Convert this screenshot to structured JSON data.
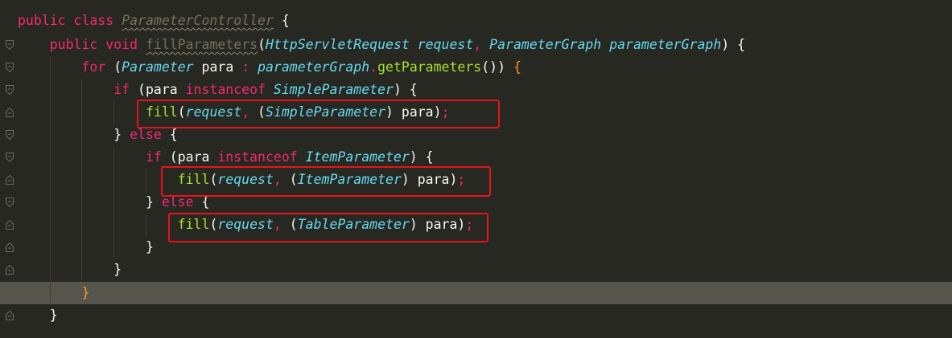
{
  "lines": [
    {
      "tokens": [
        [
          "kw",
          "public"
        ],
        [
          "plain",
          " "
        ],
        [
          "kw",
          "class"
        ],
        [
          "plain",
          " "
        ],
        [
          "clsu",
          "ParameterController"
        ],
        [
          "plain",
          " {"
        ]
      ]
    },
    {
      "tokens": [
        [
          "plain",
          "    "
        ],
        [
          "kw",
          "public"
        ],
        [
          "plain",
          " "
        ],
        [
          "kw",
          "void"
        ],
        [
          "plain",
          " "
        ],
        [
          "mu",
          "fillParameters"
        ],
        [
          "plain",
          "("
        ],
        [
          "typ",
          "HttpServletRequest"
        ],
        [
          "plain",
          " "
        ],
        [
          "prm",
          "request"
        ],
        [
          "kw",
          ","
        ],
        [
          "plain",
          " "
        ],
        [
          "typ",
          "ParameterGraph"
        ],
        [
          "plain",
          " "
        ],
        [
          "prm",
          "parameterGraph"
        ],
        [
          "plain",
          ") {"
        ]
      ]
    },
    {
      "tokens": [
        [
          "plain",
          "        "
        ],
        [
          "kw",
          "for"
        ],
        [
          "plain",
          " ("
        ],
        [
          "typ",
          "Parameter"
        ],
        [
          "plain",
          " para "
        ],
        [
          "kw",
          ":"
        ],
        [
          "plain",
          " "
        ],
        [
          "prm",
          "parameterGraph"
        ],
        [
          "kw",
          "."
        ],
        [
          "fn",
          "getParameters"
        ],
        [
          "plain",
          "()) "
        ],
        [
          "bh",
          "{"
        ]
      ]
    },
    {
      "tokens": [
        [
          "plain",
          "            "
        ],
        [
          "kw",
          "if"
        ],
        [
          "plain",
          " (para "
        ],
        [
          "kw",
          "instanceof"
        ],
        [
          "plain",
          " "
        ],
        [
          "typ",
          "SimpleParameter"
        ],
        [
          "plain",
          ") {"
        ]
      ]
    },
    {
      "tokens": [
        [
          "plain",
          "                "
        ],
        [
          "fn",
          "fill"
        ],
        [
          "plain",
          "("
        ],
        [
          "prm",
          "request"
        ],
        [
          "kw",
          ","
        ],
        [
          "plain",
          " ("
        ],
        [
          "typ",
          "SimpleParameter"
        ],
        [
          "plain",
          ") para)"
        ],
        [
          "semi",
          ";"
        ]
      ]
    },
    {
      "tokens": [
        [
          "plain",
          "            } "
        ],
        [
          "kw",
          "else"
        ],
        [
          "plain",
          " {"
        ]
      ]
    },
    {
      "tokens": [
        [
          "plain",
          "                "
        ],
        [
          "kw",
          "if"
        ],
        [
          "plain",
          " (para "
        ],
        [
          "kw",
          "instanceof"
        ],
        [
          "plain",
          " "
        ],
        [
          "typ",
          "ItemParameter"
        ],
        [
          "plain",
          ") {"
        ]
      ]
    },
    {
      "tokens": [
        [
          "plain",
          "                    "
        ],
        [
          "fn",
          "fill"
        ],
        [
          "plain",
          "("
        ],
        [
          "prm",
          "request"
        ],
        [
          "kw",
          ","
        ],
        [
          "plain",
          " ("
        ],
        [
          "typ",
          "ItemParameter"
        ],
        [
          "plain",
          ") para)"
        ],
        [
          "semi",
          ";"
        ]
      ]
    },
    {
      "tokens": [
        [
          "plain",
          "                } "
        ],
        [
          "kw",
          "else"
        ],
        [
          "plain",
          " {"
        ]
      ]
    },
    {
      "tokens": [
        [
          "plain",
          "                    "
        ],
        [
          "fn",
          "fill"
        ],
        [
          "plain",
          "("
        ],
        [
          "prm",
          "request"
        ],
        [
          "kw",
          ","
        ],
        [
          "plain",
          " ("
        ],
        [
          "typ",
          "TableParameter"
        ],
        [
          "plain",
          ") para)"
        ],
        [
          "semi",
          ";"
        ]
      ]
    },
    {
      "tokens": [
        [
          "plain",
          "                }"
        ]
      ]
    },
    {
      "tokens": [
        [
          "plain",
          "            }"
        ]
      ]
    },
    {
      "tokens": [
        [
          "plain",
          "        "
        ],
        [
          "bh",
          "}"
        ]
      ]
    },
    {
      "tokens": [
        [
          "plain",
          "    }"
        ]
      ]
    }
  ],
  "current_line_index": 12,
  "colors": {
    "background": "#272822",
    "current_line": "#55554b",
    "highlight_box": "#e8131a",
    "keyword": "#f92672",
    "type": "#66d9ef",
    "function": "#a6e22e",
    "text": "#f8f8f2",
    "matched_brace": "#fd971f"
  },
  "gutter": {
    "fold_markers": [
      "fold-open-icon",
      "fold-open-icon",
      "fold-open-icon",
      "fold-close-icon",
      "fold-open-icon",
      "fold-open-icon",
      "fold-close-icon",
      "fold-open-icon",
      "fold-close-icon",
      "fold-close-icon",
      "fold-close-icon",
      "fold-close-icon",
      "fold-close-icon"
    ],
    "current_marker": "lock-icon"
  }
}
